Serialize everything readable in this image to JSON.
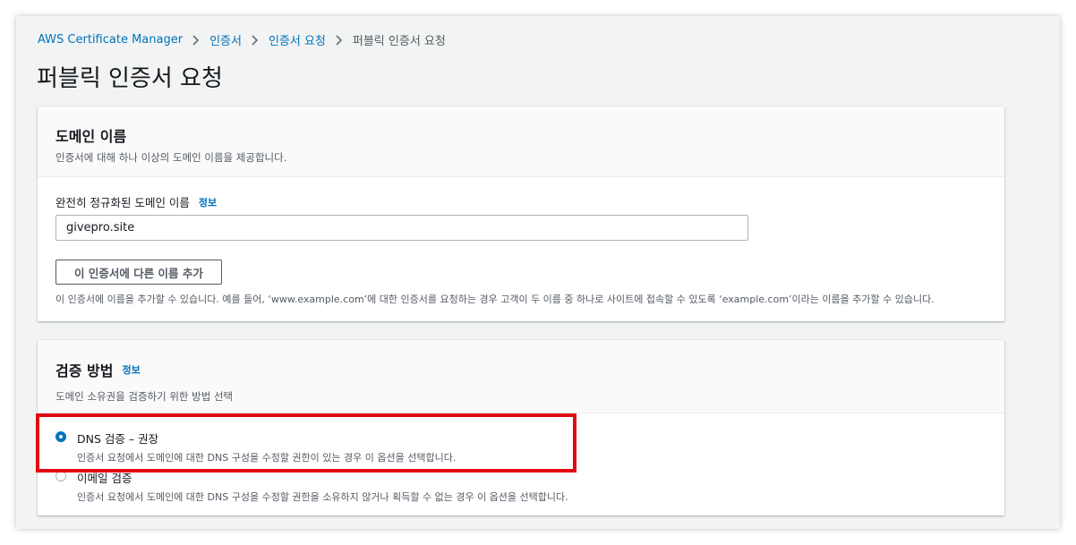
{
  "breadcrumb": {
    "items": [
      "AWS Certificate Manager",
      "인증서",
      "인증서 요청"
    ],
    "current": "퍼블릭 인증서 요청"
  },
  "page": {
    "title": "퍼블릭 인증서 요청"
  },
  "domain_panel": {
    "title": "도메인 이름",
    "description": "인증서에 대해 하나 이상의 도메인 이름을 제공합니다.",
    "field_label": "완전히 정규화된 도메인 이름",
    "info_link": "정보",
    "input_value": "givepro.site",
    "add_button": "이 인증서에 다른 이름 추가",
    "hint": "이 인증서에 이름을 추가할 수 있습니다. 예를 들어, ‘www.example.com’에 대한 인증서를 요청하는 경우 고객이 두 이름 중 하나로 사이트에 접속할 수 있도록 ‘example.com’이라는 이름을 추가할 수 있습니다."
  },
  "validation_panel": {
    "title": "검증 방법",
    "info_link": "정보",
    "description": "도메인 소유권을 검증하기 위한 방법 선택",
    "options": [
      {
        "label": "DNS 검증 – 권장",
        "description": "인증서 요청에서 도메인에 대한 DNS 구성을 수정할 권한이 있는 경우 이 옵션을 선택합니다.",
        "selected": true
      },
      {
        "label": "이메일 검증",
        "description": "인증서 요청에서 도메인에 대한 DNS 구성을 수정할 권한을 소유하지 않거나 획득할 수 없는 경우 이 옵션을 선택합니다.",
        "selected": false
      }
    ]
  },
  "colors": {
    "link": "#0073bb",
    "highlight": "#e30613",
    "page_background": "#f2f3f3"
  },
  "icons": {
    "separator": "chevron-right-icon"
  }
}
